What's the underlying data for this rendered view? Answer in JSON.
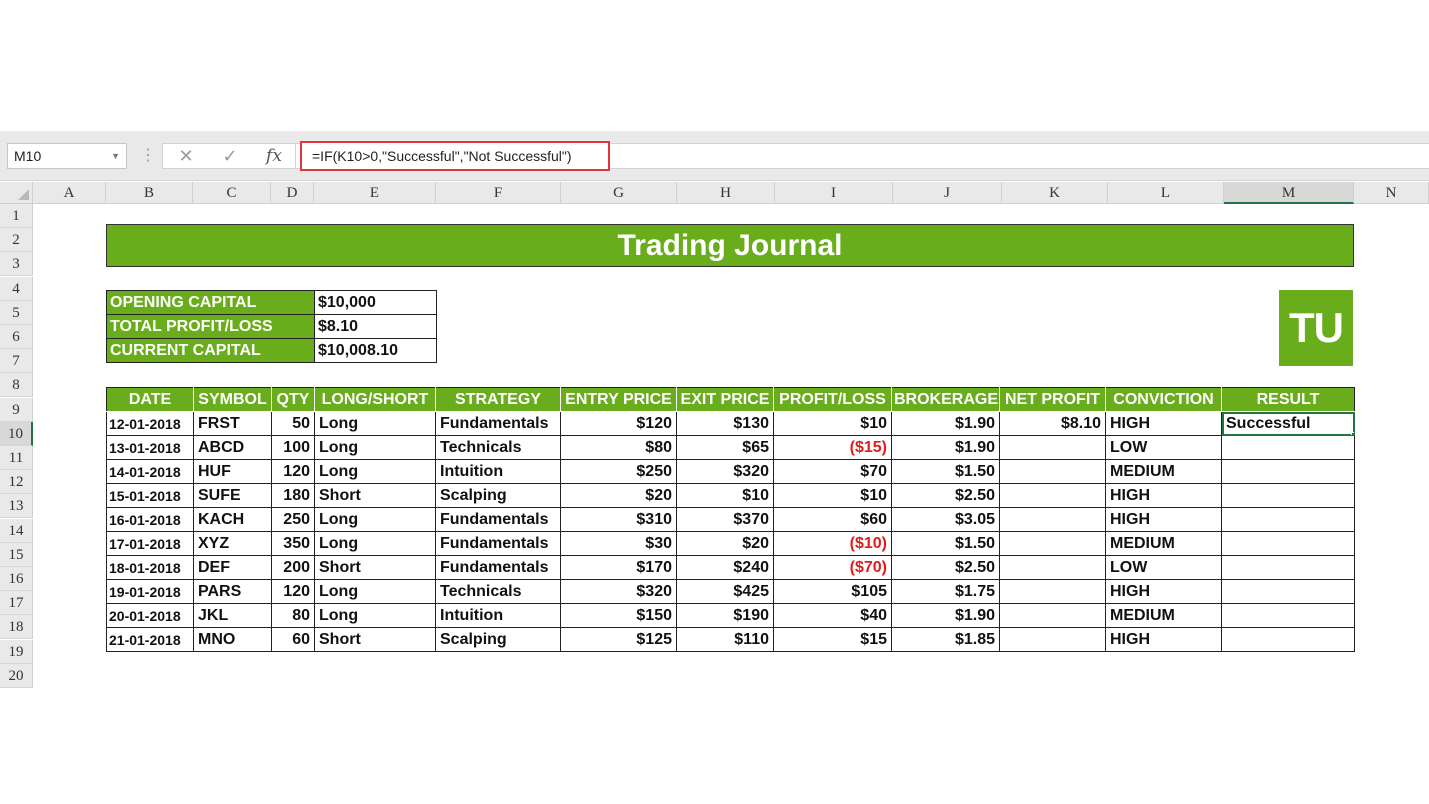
{
  "formula_bar": {
    "name_box": "M10",
    "cancel_icon": "close-icon",
    "enter_icon": "check-icon",
    "function_icon": "fx-icon",
    "function_label": "fx",
    "formula": "=IF(K10>0,\"Successful\",\"Not Successful\")"
  },
  "columns": [
    "A",
    "B",
    "C",
    "D",
    "E",
    "F",
    "G",
    "H",
    "I",
    "J",
    "K",
    "L",
    "M",
    "N"
  ],
  "rows": [
    "1",
    "2",
    "3",
    "4",
    "5",
    "6",
    "7",
    "8",
    "9",
    "10",
    "11",
    "12",
    "13",
    "14",
    "15",
    "16",
    "17",
    "18",
    "19",
    "20"
  ],
  "selected_cell": {
    "column": "M",
    "row": "10"
  },
  "sheet": {
    "title": "Trading Journal",
    "summary": [
      {
        "label": "OPENING CAPITAL",
        "value": "$10,000"
      },
      {
        "label": "TOTAL PROFIT/LOSS",
        "value": "$8.10"
      },
      {
        "label": "CURRENT CAPITAL",
        "value": "$10,008.10"
      }
    ],
    "logo": "TU",
    "headers": [
      "DATE",
      "SYMBOL",
      "QTY",
      "LONG/SHORT",
      "STRATEGY",
      "ENTRY PRICE",
      "EXIT PRICE",
      "PROFIT/LOSS",
      "BROKERAGE",
      "NET PROFIT",
      "CONVICTION",
      "RESULT"
    ],
    "trades": [
      [
        "12-01-2018",
        "FRST",
        "50",
        "Long",
        "Fundamentals",
        "$120",
        "$130",
        "$10",
        "$1.90",
        "$8.10",
        "HIGH",
        "Successful"
      ],
      [
        "13-01-2018",
        "ABCD",
        "100",
        "Long",
        "Technicals",
        "$80",
        "$65",
        "($15)",
        "$1.90",
        "",
        "LOW",
        ""
      ],
      [
        "14-01-2018",
        "HUF",
        "120",
        "Long",
        "Intuition",
        "$250",
        "$320",
        "$70",
        "$1.50",
        "",
        "MEDIUM",
        ""
      ],
      [
        "15-01-2018",
        "SUFE",
        "180",
        "Short",
        "Scalping",
        "$20",
        "$10",
        "$10",
        "$2.50",
        "",
        "HIGH",
        ""
      ],
      [
        "16-01-2018",
        "KACH",
        "250",
        "Long",
        "Fundamentals",
        "$310",
        "$370",
        "$60",
        "$3.05",
        "",
        "HIGH",
        ""
      ],
      [
        "17-01-2018",
        "XYZ",
        "350",
        "Long",
        "Fundamentals",
        "$30",
        "$20",
        "($10)",
        "$1.50",
        "",
        "MEDIUM",
        ""
      ],
      [
        "18-01-2018",
        "DEF",
        "200",
        "Short",
        "Fundamentals",
        "$170",
        "$240",
        "($70)",
        "$2.50",
        "",
        "LOW",
        ""
      ],
      [
        "19-01-2018",
        "PARS",
        "120",
        "Long",
        "Technicals",
        "$320",
        "$425",
        "$105",
        "$1.75",
        "",
        "HIGH",
        ""
      ],
      [
        "20-01-2018",
        "JKL",
        "80",
        "Long",
        "Intuition",
        "$150",
        "$190",
        "$40",
        "$1.90",
        "",
        "MEDIUM",
        ""
      ],
      [
        "21-01-2018",
        "MNO",
        "60",
        "Short",
        "Scalping",
        "$125",
        "$110",
        "$15",
        "$1.85",
        "",
        "HIGH",
        ""
      ]
    ],
    "negative_color": "#e21b1b",
    "accent_color": "#6aad1c"
  }
}
